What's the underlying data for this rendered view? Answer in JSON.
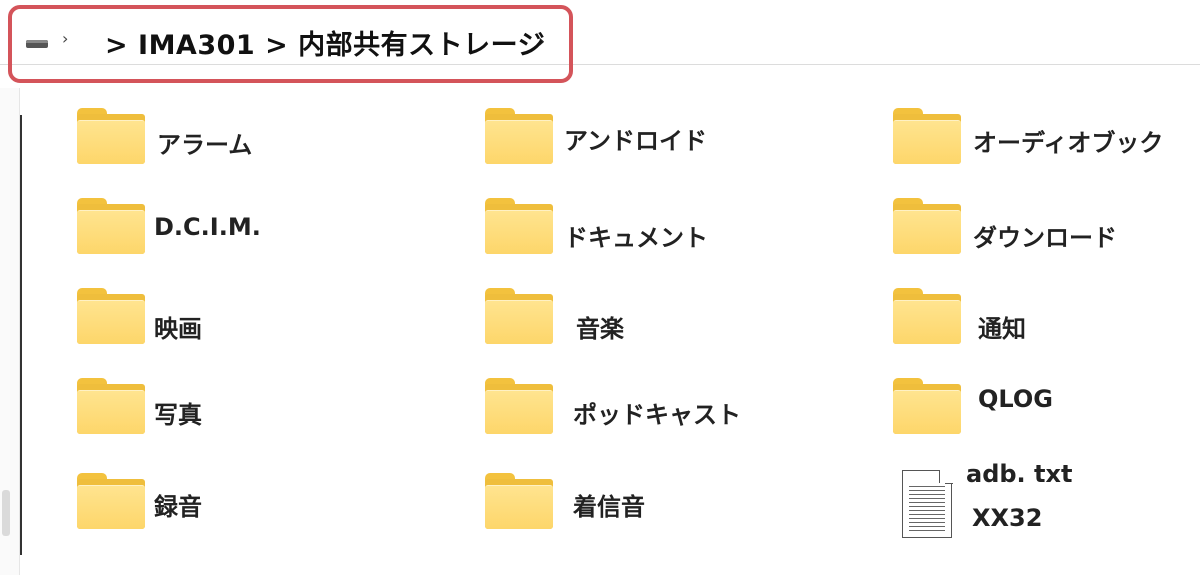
{
  "breadcrumb": {
    "path_text": "> IMA301 > 内部共有ストレージ",
    "leading_chevron": "›",
    "trailing_chevron": "›",
    "drive_icon": "drive-icon"
  },
  "items": [
    {
      "label": "アラーム",
      "type": "folder"
    },
    {
      "label": "アンドロイド",
      "type": "folder"
    },
    {
      "label": "オーディオブック",
      "type": "folder"
    },
    {
      "label": "D.C.I.M.",
      "type": "folder"
    },
    {
      "label": "ドキュメント",
      "type": "folder"
    },
    {
      "label": "ダウンロード",
      "type": "folder"
    },
    {
      "label": "映画",
      "type": "folder"
    },
    {
      "label": "音楽",
      "type": "folder"
    },
    {
      "label": "通知",
      "type": "folder"
    },
    {
      "label": "写真",
      "type": "folder"
    },
    {
      "label": "ポッドキャスト",
      "type": "folder"
    },
    {
      "label": "QLOG",
      "type": "folder"
    },
    {
      "label": "録音",
      "type": "folder"
    },
    {
      "label": "着信音",
      "type": "folder"
    },
    {
      "label": "adb. txt",
      "sub_label": "XX32",
      "type": "file"
    }
  ],
  "colors": {
    "highlight_border": "#d4545a",
    "folder_front": "#fdd66a",
    "folder_back": "#efbe3c"
  }
}
